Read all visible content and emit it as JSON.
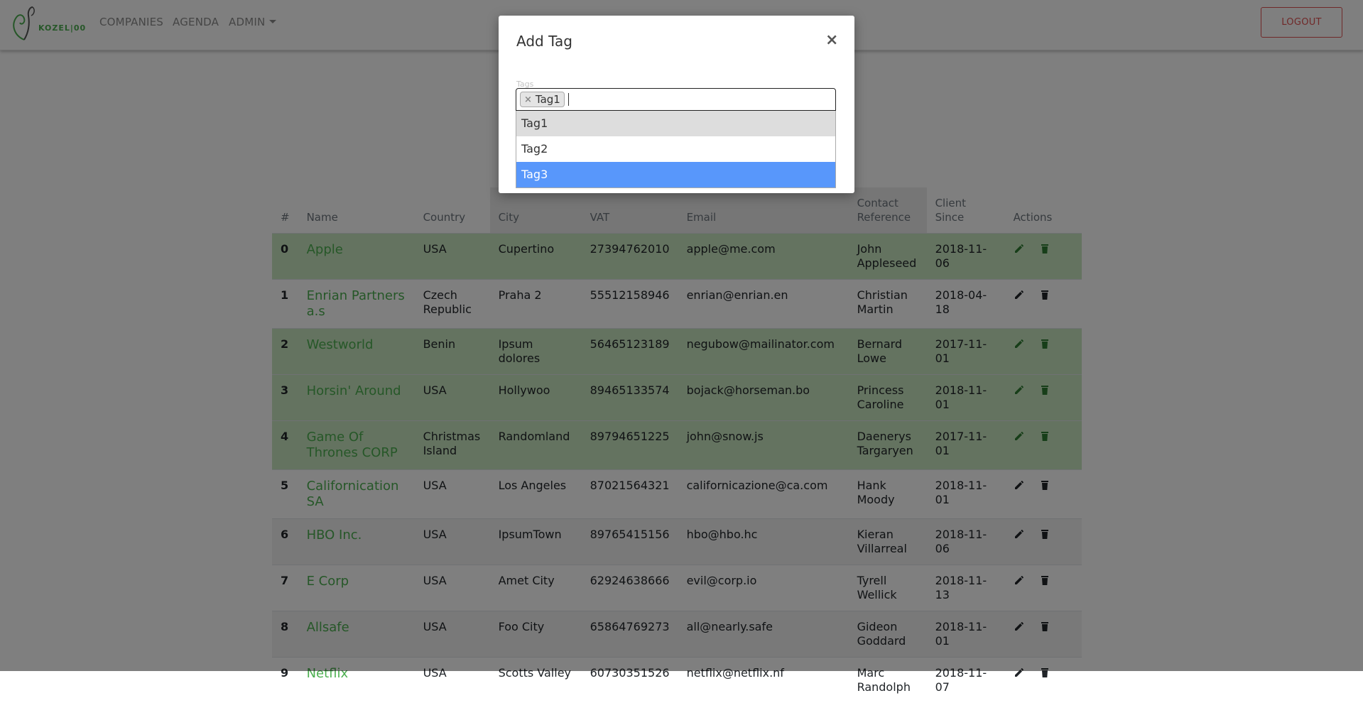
{
  "nav": {
    "logo_text": "KOZEL|00",
    "links": [
      "COMPANIES",
      "AGENDA",
      "ADMIN"
    ],
    "logout_label": "LOGOUT"
  },
  "table": {
    "headers": [
      "#",
      "Name",
      "Country",
      "City",
      "VAT",
      "Email",
      "Contact Reference",
      "Client Since",
      "Actions"
    ],
    "rows": [
      {
        "idx": "0",
        "name": "Apple",
        "country": "USA",
        "city": "Cupertino",
        "vat": "27394762010",
        "email": "apple@me.com",
        "contact": "John Appleseed",
        "since": "2018-11-06"
      },
      {
        "idx": "1",
        "name": "Enrian Partners a.s",
        "country": "Czech Republic",
        "city": "Praha 2",
        "vat": "55512158946",
        "email": "enrian@enrian.en",
        "contact": "Christian Martin",
        "since": "2018-04-18"
      },
      {
        "idx": "2",
        "name": "Westworld",
        "country": "Benin",
        "city": "Ipsum dolores",
        "vat": "56465123189",
        "email": "negubow@mailinator.com",
        "contact": "Bernard Lowe",
        "since": "2017-11-01"
      },
      {
        "idx": "3",
        "name": "Horsin' Around",
        "country": "USA",
        "city": "Hollywoo",
        "vat": "89465133574",
        "email": "bojack@horseman.bo",
        "contact": "Princess Caroline",
        "since": "2018-11-01"
      },
      {
        "idx": "4",
        "name": "Game Of Thrones CORP",
        "country": "Christmas Island",
        "city": "Randomland",
        "vat": "89794651225",
        "email": "john@snow.js",
        "contact": "Daenerys Targaryen",
        "since": "2017-11-01"
      },
      {
        "idx": "5",
        "name": "Californication SA",
        "country": "USA",
        "city": "Los Angeles",
        "vat": "87021564321",
        "email": "californicazione@ca.com",
        "contact": "Hank Moody",
        "since": "2018-11-01"
      },
      {
        "idx": "6",
        "name": "HBO Inc.",
        "country": "USA",
        "city": "IpsumTown",
        "vat": "89765415156",
        "email": "hbo@hbo.hc",
        "contact": "Kieran Villarreal",
        "since": "2018-11-06"
      },
      {
        "idx": "7",
        "name": "E Corp",
        "country": "USA",
        "city": "Amet City",
        "vat": "62924638666",
        "email": "evil@corp.io",
        "contact": "Tyrell Wellick",
        "since": "2018-11-13"
      },
      {
        "idx": "8",
        "name": "Allsafe",
        "country": "USA",
        "city": "Foo City",
        "vat": "65864769273",
        "email": "all@nearly.safe",
        "contact": "Gideon Goddard",
        "since": "2018-11-01"
      },
      {
        "idx": "9",
        "name": "Netflix",
        "country": "USA",
        "city": "Scotts Valley",
        "vat": "60730351526",
        "email": "netflix@netflix.nf",
        "contact": "Marc Randolph",
        "since": "2018-11-07"
      }
    ]
  },
  "modal": {
    "title": "Add Tag",
    "close_symbol": "×",
    "field_label": "Tags",
    "selected_tags": [
      "Tag1"
    ],
    "chip_remove_symbol": "×",
    "options": [
      "Tag1",
      "Tag2",
      "Tag3"
    ],
    "selected_option": "Tag1",
    "highlighted_option": "Tag3"
  },
  "colors": {
    "accent_green": "#4caf50",
    "row_highlight": "#c9e7c0",
    "logout_red": "#e05252",
    "option_highlight": "#5897fb"
  }
}
